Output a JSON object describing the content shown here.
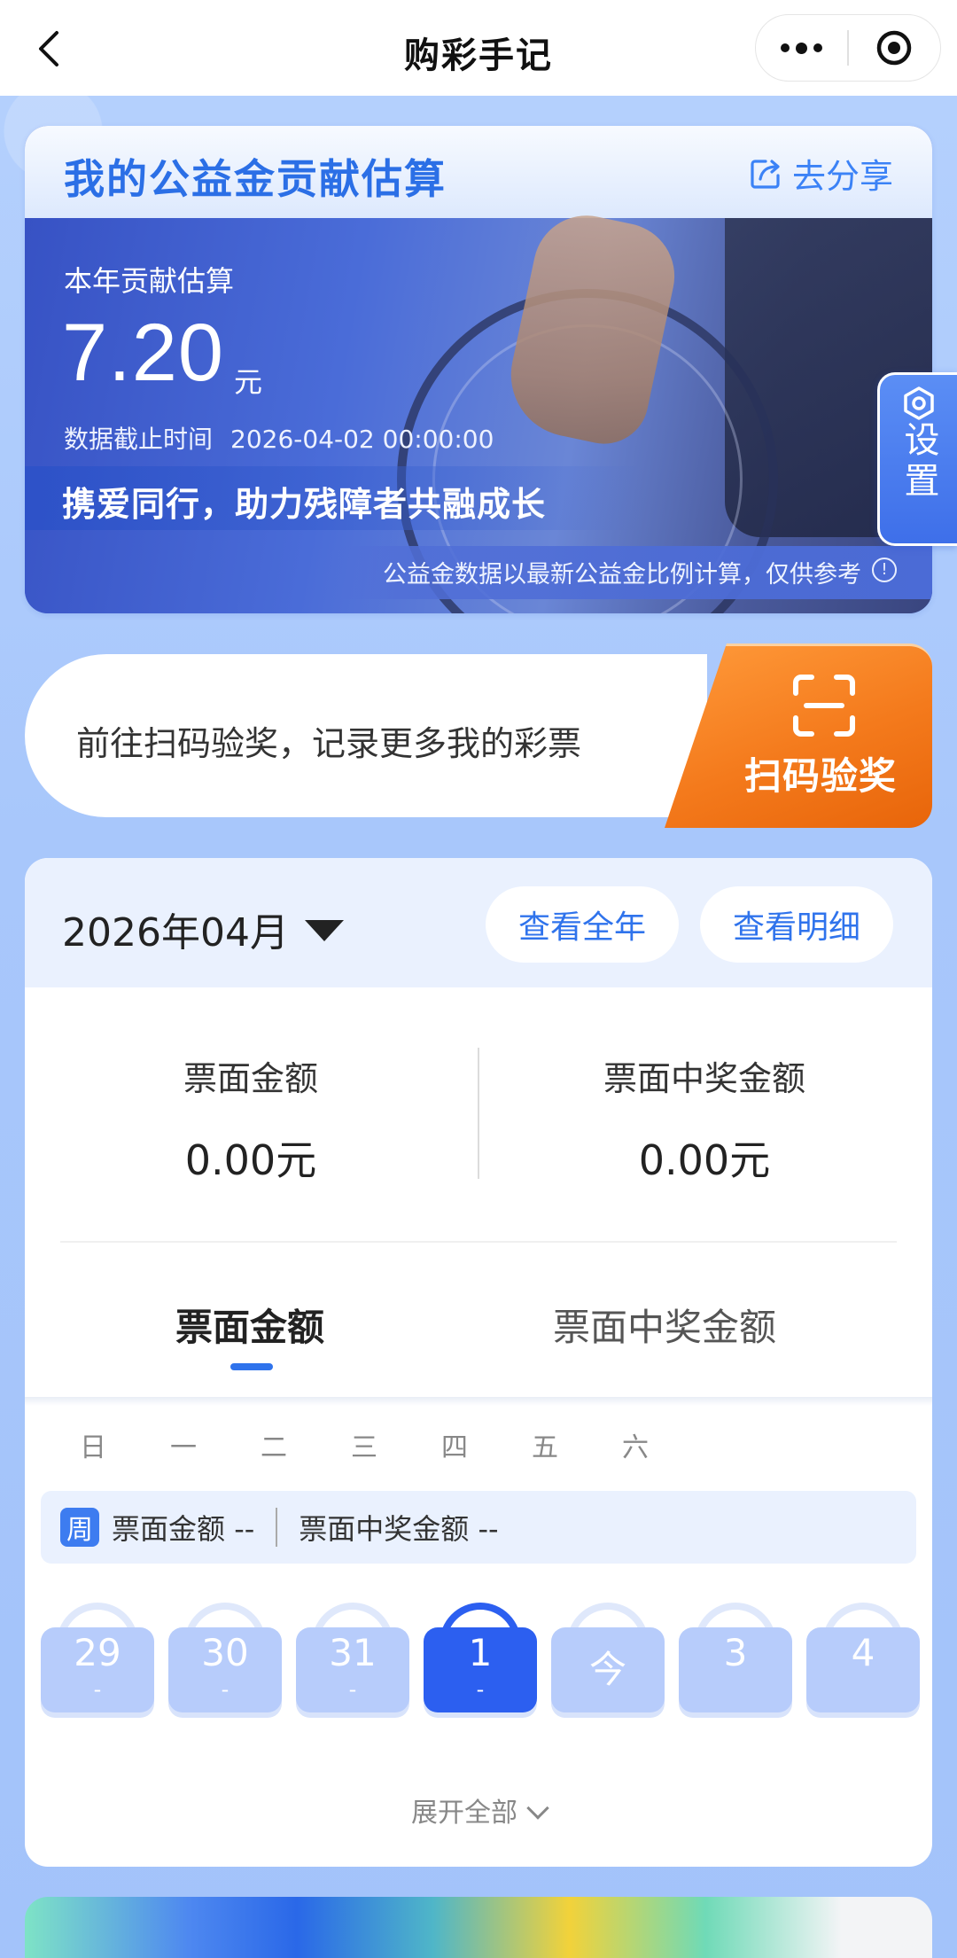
{
  "nav": {
    "title": "购彩手记"
  },
  "contribution": {
    "title": "我的公益金贡献估算",
    "share_label": "去分享",
    "year_label": "本年贡献估算",
    "amount": "7.20",
    "unit": "元",
    "cutoff_label": "数据截止时间",
    "cutoff_time": "2026-04-02 00:00:00",
    "slogan": "携爱同行，助力残障者共融成长",
    "note": "公益金数据以最新公益金比例计算，仅供参考"
  },
  "settings_tab": {
    "label": "设置"
  },
  "scan": {
    "text": "前往扫码验奖，记录更多我的彩票",
    "button_label": "扫码验奖"
  },
  "records": {
    "month": "2026年04月",
    "view_year": "查看全年",
    "view_detail": "查看明细",
    "summary": [
      {
        "label": "票面金额",
        "value": "0.00元"
      },
      {
        "label": "票面中奖金额",
        "value": "0.00元"
      }
    ],
    "tabs": [
      "票面金额",
      "票面中奖金额"
    ],
    "active_tab": 0,
    "weekdays": [
      "日",
      "一",
      "二",
      "三",
      "四",
      "五",
      "六"
    ],
    "week_summary": {
      "badge": "周",
      "face_label": "票面金额",
      "face_value": "--",
      "win_label": "票面中奖金额",
      "win_value": "--"
    },
    "days": [
      {
        "num": "29",
        "sub": "-"
      },
      {
        "num": "30",
        "sub": "-"
      },
      {
        "num": "31",
        "sub": "-"
      },
      {
        "num": "1",
        "sub": "-",
        "selected": true
      },
      {
        "num": "今",
        "sub": ""
      },
      {
        "num": "3",
        "sub": ""
      },
      {
        "num": "4",
        "sub": ""
      }
    ],
    "expand_label": "展开全部"
  },
  "colors": {
    "accent": "#2f73ec",
    "scan_orange": "#f47a1c",
    "page_bg": "#a9c8fb"
  }
}
